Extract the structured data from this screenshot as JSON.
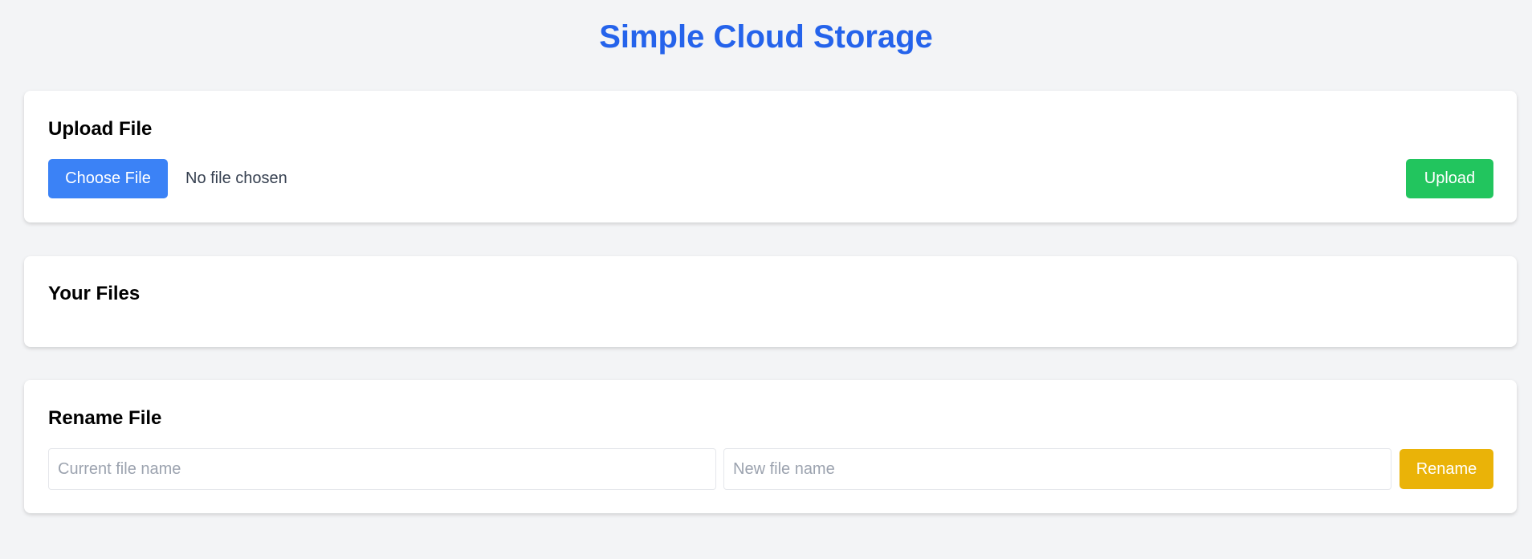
{
  "title": "Simple Cloud Storage",
  "upload": {
    "heading": "Upload File",
    "choose_label": "Choose File",
    "no_file": "No file chosen",
    "upload_label": "Upload"
  },
  "files": {
    "heading": "Your Files"
  },
  "rename": {
    "heading": "Rename File",
    "current_placeholder": "Current file name",
    "new_placeholder": "New file name",
    "rename_label": "Rename"
  },
  "colors": {
    "accent": "#2563eb",
    "choose": "#3b82f6",
    "upload": "#22c55e",
    "rename": "#eab308"
  }
}
